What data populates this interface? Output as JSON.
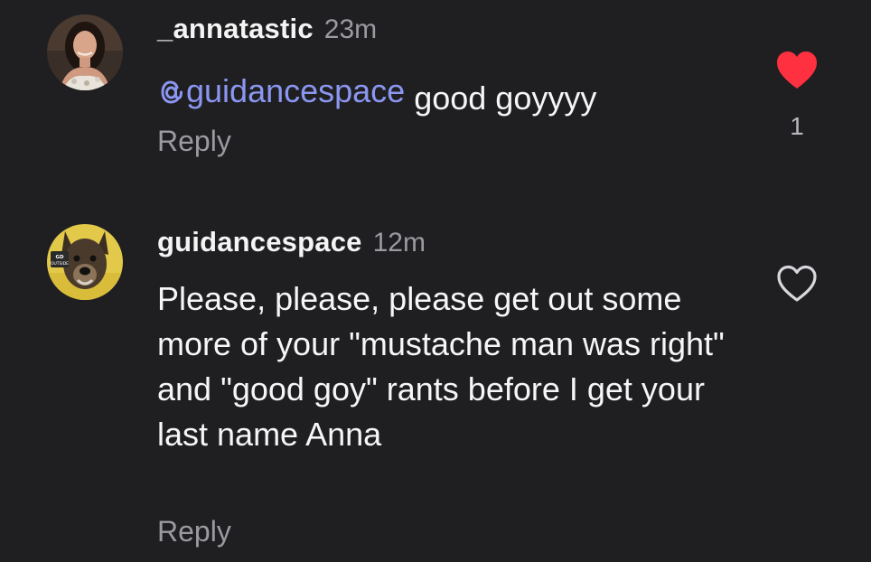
{
  "comments": [
    {
      "username": "_annatastic",
      "timestamp": "23m",
      "mention": "guidancespace",
      "text": " good goyyyy",
      "reply_label": "Reply",
      "liked": true,
      "like_count": "1",
      "heart_color": "#ff3040",
      "avatar": "woman-portrait-avatar"
    },
    {
      "username": "guidancespace",
      "timestamp": "12m",
      "text": "Please, please, please get out some more of your \"mustache man was right\" and \"good goy\" rants before I get your last name Anna",
      "reply_label": "Reply",
      "liked": false,
      "avatar": "dog-portrait-avatar",
      "avatar_badge_text": "GD OUTSIDE"
    }
  ],
  "colors": {
    "background": "#1f1f22",
    "mention": "#8b96f0",
    "muted_text": "#9a9aa0"
  }
}
